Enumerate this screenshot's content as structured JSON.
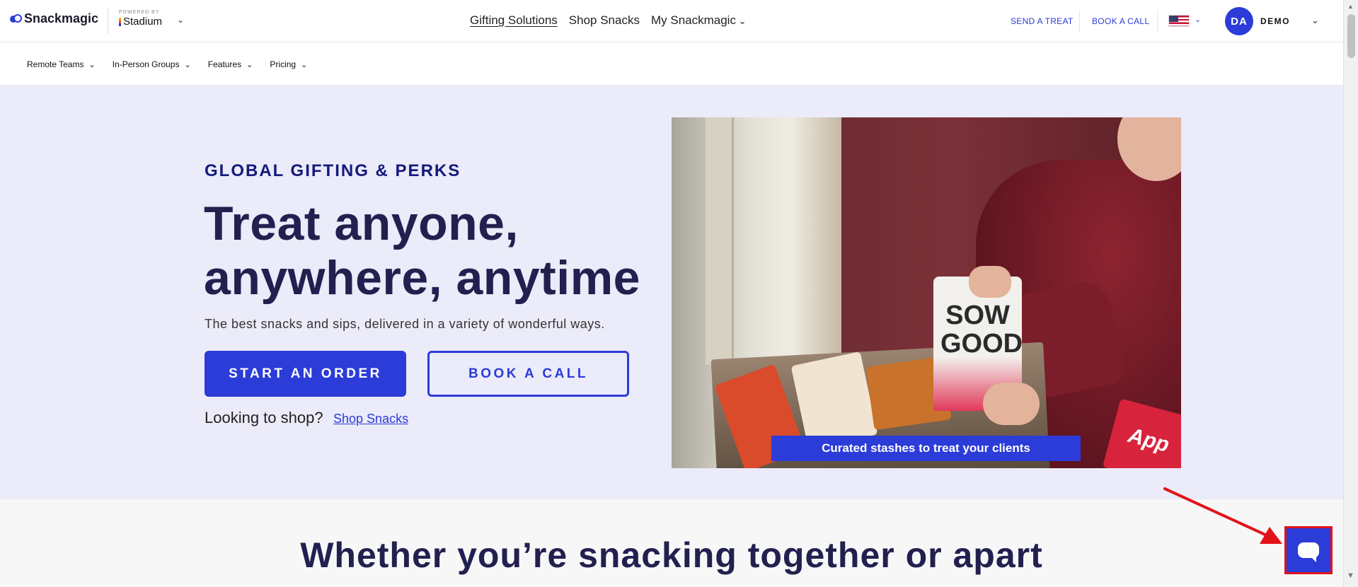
{
  "header": {
    "brand": "Snackmagic",
    "powered_by": "POWERED BY",
    "partner": "Stadium",
    "nav": [
      {
        "label": "Gifting Solutions"
      },
      {
        "label": "Shop Snacks"
      },
      {
        "label": "My Snackmagic"
      }
    ],
    "send_treat": "SEND A TREAT",
    "book_call": "BOOK A CALL",
    "avatar_initials": "DA",
    "account_name": "DEMO"
  },
  "subnav": {
    "items": [
      {
        "label": "Remote Teams"
      },
      {
        "label": "In-Person Groups"
      },
      {
        "label": "Features"
      },
      {
        "label": "Pricing"
      }
    ]
  },
  "hero": {
    "eyebrow": "GLOBAL GIFTING & PERKS",
    "headline_line1": "Treat anyone,",
    "headline_line2": "anywhere, anytime",
    "subtitle": "The best snacks and sips, delivered in a variety of wonderful ways.",
    "cta_primary": "START AN ORDER",
    "cta_secondary": "BOOK A CALL",
    "shop_prompt": "Looking to shop?",
    "shop_link": "Shop Snacks",
    "image_caption": "Curated stashes to treat your clients",
    "pouch_text": "SOW GOOD",
    "can_text": "App"
  },
  "section": {
    "title": "Whether you’re snacking together or apart"
  },
  "colors": {
    "accent": "#2b3cd8",
    "hero_bg": "#ebebf9",
    "heading": "#22204f",
    "highlight": "#e3121a"
  }
}
